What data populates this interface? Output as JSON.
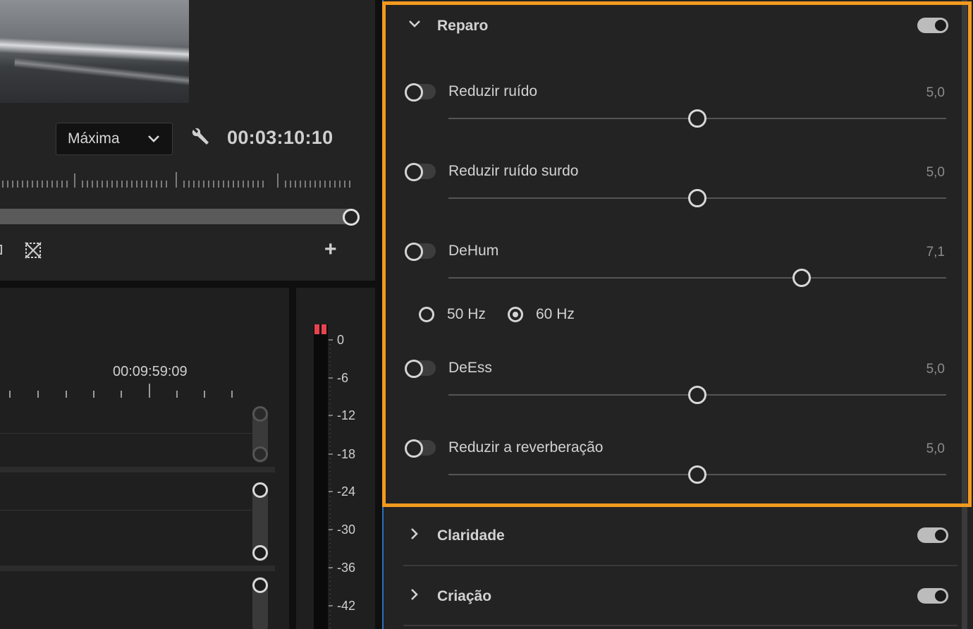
{
  "monitor": {
    "quality": "Máxima",
    "timecode": "00:03:10:10"
  },
  "timeline": {
    "timecode": "00:09:59:09"
  },
  "meter": {
    "labels": [
      "0",
      "-6",
      "-12",
      "-18",
      "-24",
      "-30",
      "-36",
      "-42"
    ]
  },
  "panel": {
    "repair": {
      "title": "Reparo",
      "enabled": true,
      "controls": [
        {
          "label": "Reduzir ruído",
          "value": "5,0",
          "enabled": false,
          "level": 5.0
        },
        {
          "label": "Reduzir ruído surdo",
          "value": "5,0",
          "enabled": false,
          "level": 5.0
        },
        {
          "label": "DeHum",
          "value": "7,1",
          "enabled": false,
          "level": 7.1
        },
        {
          "label": "DeEss",
          "value": "5,0",
          "enabled": false,
          "level": 5.0
        },
        {
          "label": "Reduzir a reverberação",
          "value": "5,0",
          "enabled": false,
          "level": 5.0
        }
      ],
      "hum_options": [
        {
          "label": "50 Hz",
          "checked": false
        },
        {
          "label": "60 Hz",
          "checked": true
        }
      ]
    },
    "clarity": {
      "title": "Claridade",
      "enabled": true
    },
    "creation": {
      "title": "Criação",
      "enabled": true
    }
  },
  "colors": {
    "highlight": "#f29a1e",
    "panel_bg": "#232323",
    "clip_indicator": "#e8434f"
  }
}
